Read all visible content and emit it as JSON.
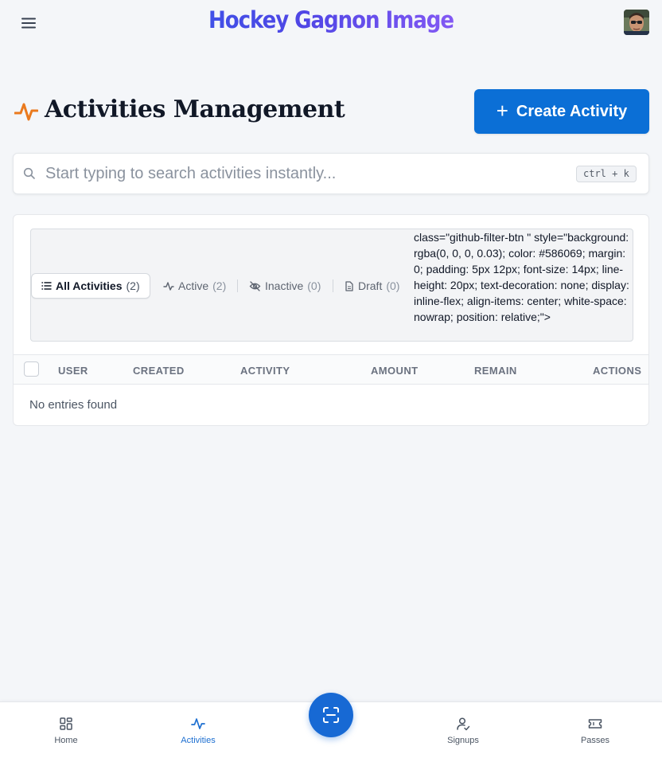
{
  "header": {
    "brand": "Hockey Gagnon Image",
    "menu_icon": "hamburger-menu-icon",
    "avatar_icon": "user-avatar"
  },
  "page": {
    "title": "Activities Management",
    "title_icon": "activity-pulse-icon",
    "create_button": "Create Activity"
  },
  "search": {
    "placeholder": "Start typing to search activities instantly...",
    "value": "",
    "shortcut": "ctrl + k"
  },
  "filters": [
    {
      "label": "All Activities",
      "count": "(2)",
      "icon": "list-icon",
      "selected": true
    },
    {
      "label": "Active",
      "count": "(2)",
      "icon": "pulse-icon",
      "selected": false
    },
    {
      "label": "Inactive",
      "count": "(0)",
      "icon": "eye-off-icon",
      "selected": false
    },
    {
      "label": "Draft",
      "count": "(0)",
      "icon": "document-icon",
      "selected": false
    }
  ],
  "raw_markup_text": "class=\"github-filter-btn \" style=\"background: rgba(0, 0, 0, 0.03); color: #586069; margin: 0; padding: 5px 12px; font-size: 14px; line-height: 20px; text-decoration: none; display: inline-flex; align-items: center; white-space: nowrap; position: relative;\">",
  "table": {
    "columns": [
      "USER",
      "CREATED",
      "ACTIVITY",
      "AMOUNT",
      "REMAIN",
      "ACTIONS"
    ],
    "rows": [],
    "empty_text": "No entries found"
  },
  "bottom_nav": {
    "items": [
      {
        "label": "Home",
        "icon": "grid-icon",
        "active": false
      },
      {
        "label": "Activities",
        "icon": "pulse-icon",
        "active": true
      },
      {
        "label": "Signups",
        "icon": "user-check-icon",
        "active": false
      },
      {
        "label": "Passes",
        "icon": "ticket-icon",
        "active": false
      }
    ],
    "fab_icon": "scan-icon"
  },
  "colors": {
    "accent": "#0b6fd6",
    "title_icon": "#ea7a1e",
    "background": "#f4f6f9"
  }
}
